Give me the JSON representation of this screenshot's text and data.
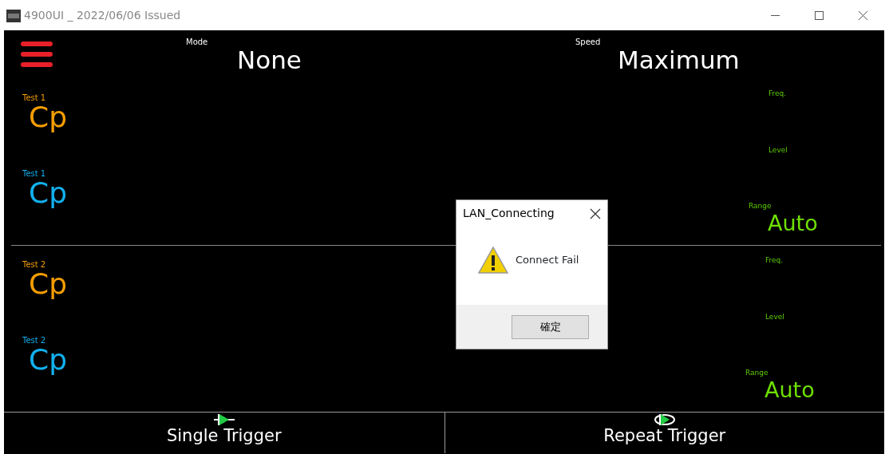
{
  "window": {
    "title": "4900UI _ 2022/06/06 Issued"
  },
  "header": {
    "mode_label": "Mode",
    "mode_value": "None",
    "speed_label": "Speed",
    "speed_value": "Maximum"
  },
  "panels": [
    {
      "tests": [
        {
          "label": "Test 1",
          "value": "Cp",
          "color": "#f59d00"
        },
        {
          "label": "Test 1",
          "value": "Cp",
          "color": "#12b0ee"
        }
      ],
      "freq_label": "Freq.",
      "level_label": "Level",
      "range_label": "Range",
      "range_value": "Auto"
    },
    {
      "tests": [
        {
          "label": "Test 2",
          "value": "Cp",
          "color": "#f59d00"
        },
        {
          "label": "Test 2",
          "value": "Cp",
          "color": "#12b0ee"
        }
      ],
      "freq_label": "Freq.",
      "level_label": "Level",
      "range_label": "Range",
      "range_value": "Auto"
    }
  ],
  "buttons": [
    {
      "label": "Single Trigger",
      "kind": "single"
    },
    {
      "label": "Repeat Trigger",
      "kind": "repeat"
    }
  ],
  "dialog": {
    "title": "LAN_Connecting",
    "message": "Connect Fail",
    "button": "確定"
  }
}
